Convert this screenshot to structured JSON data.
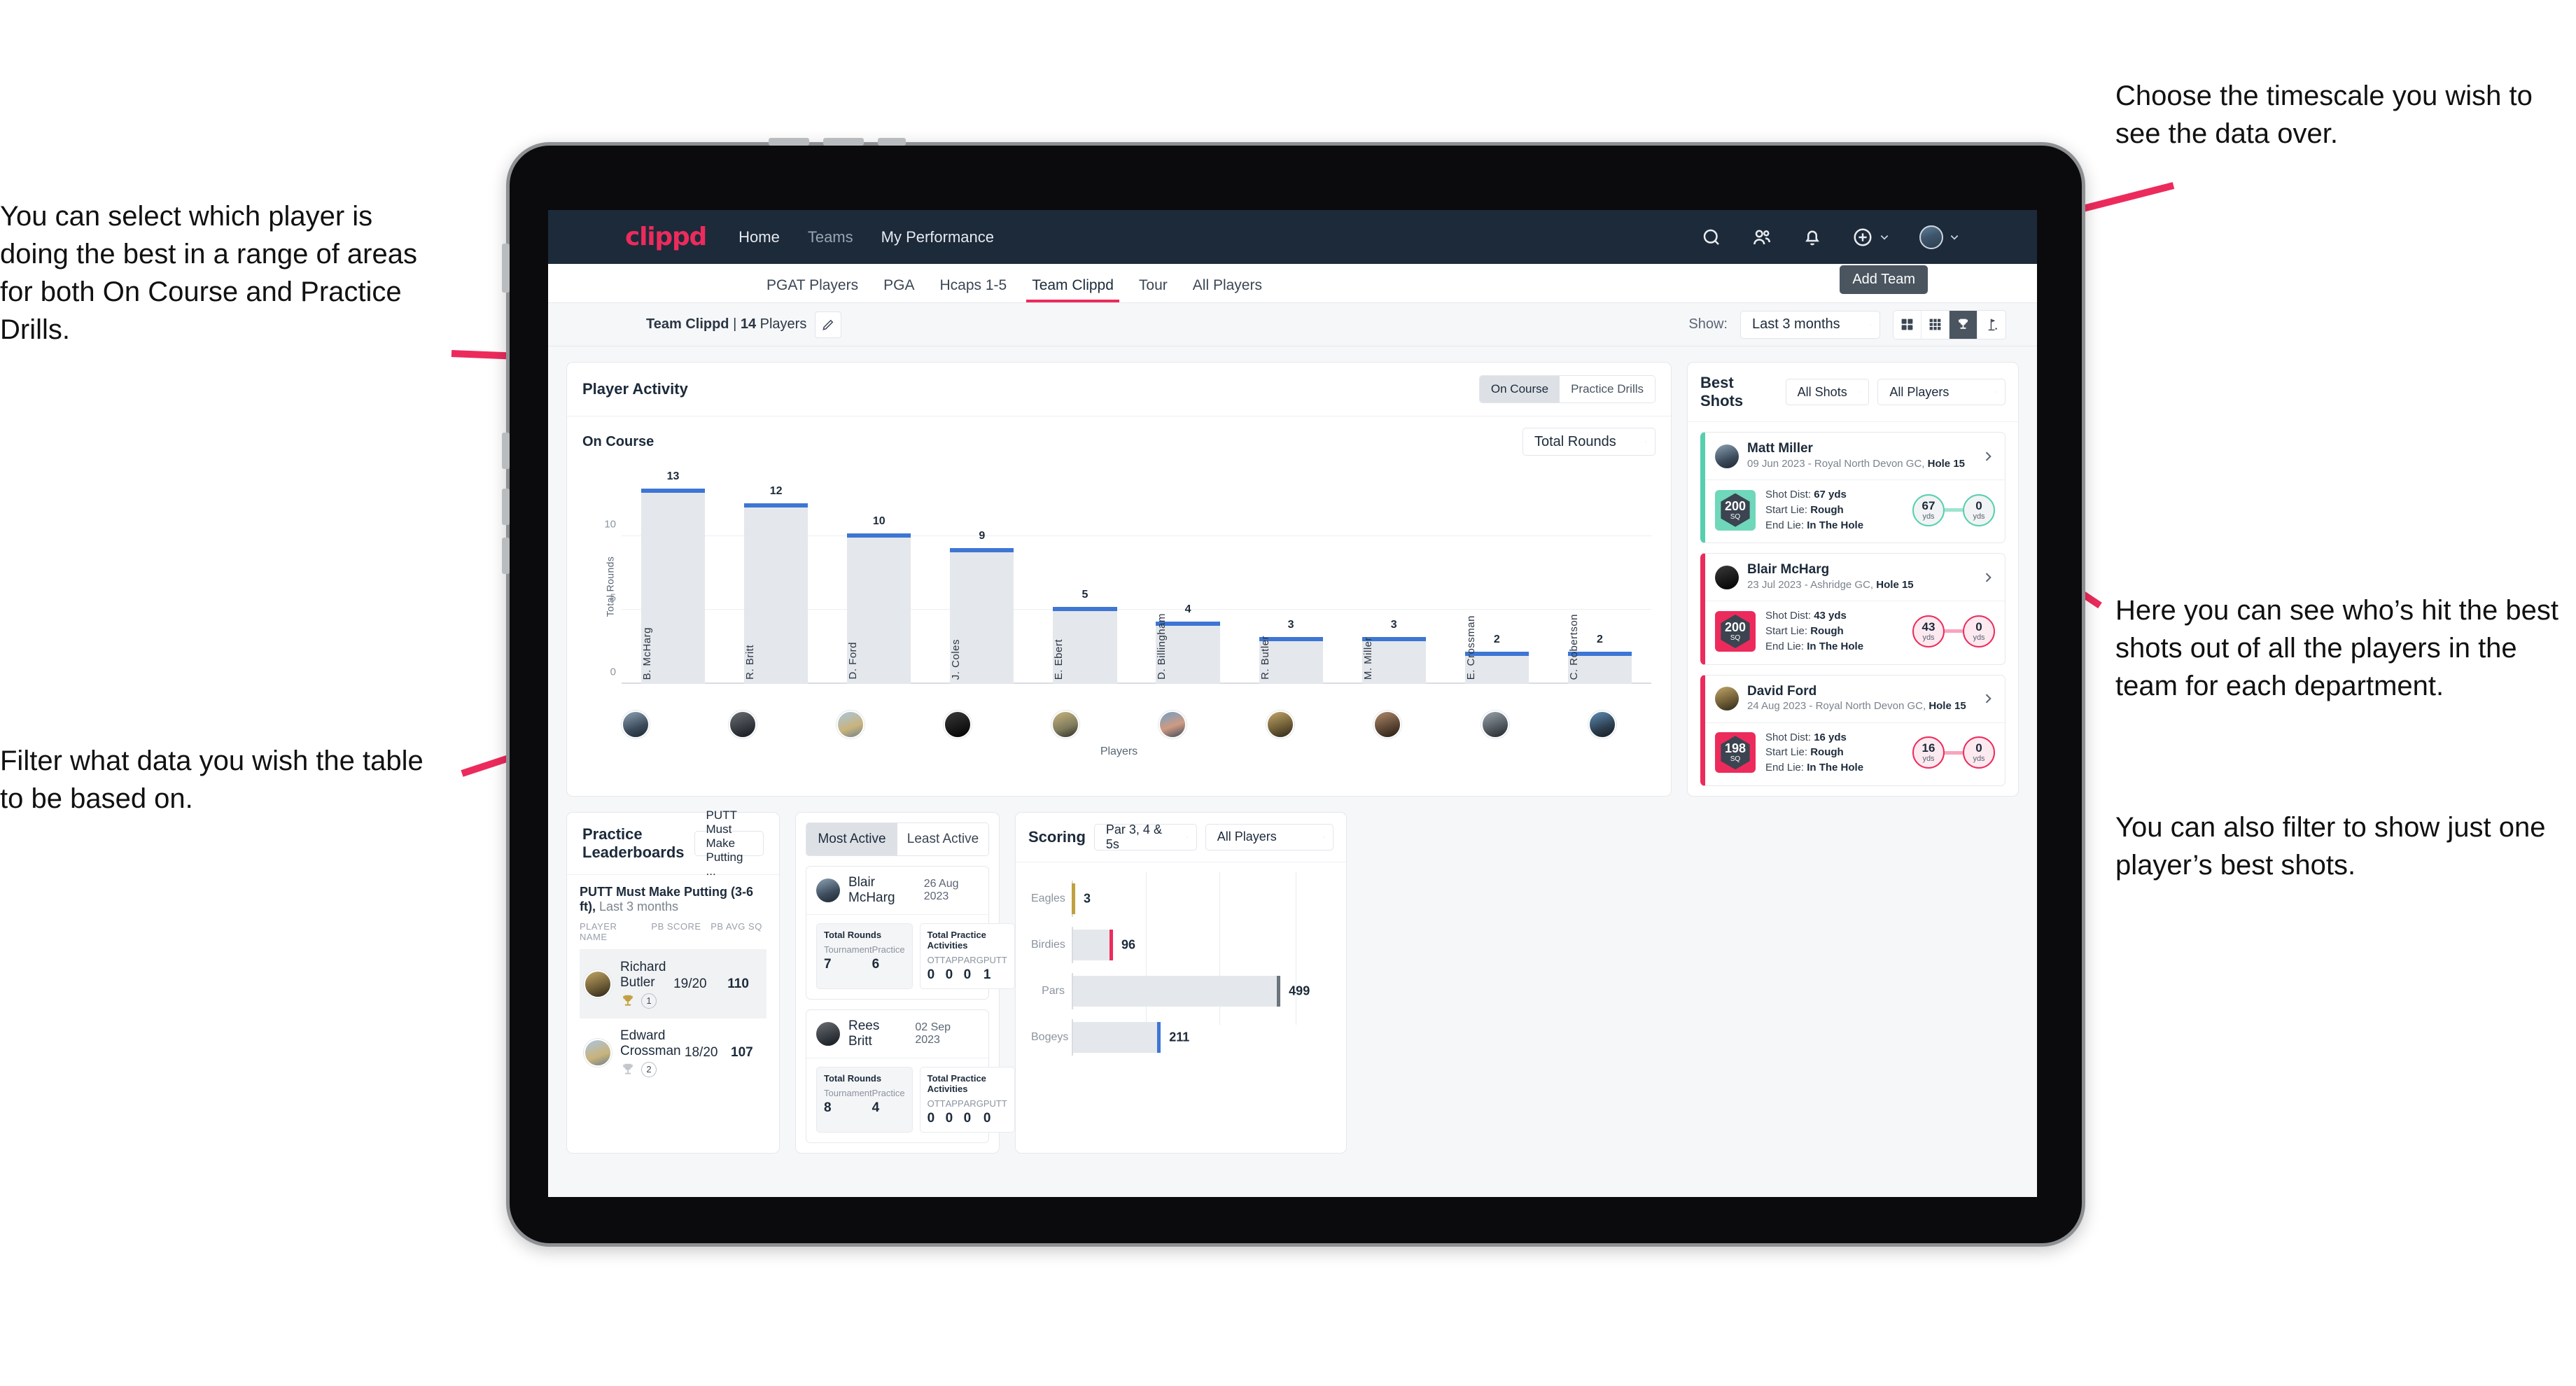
{
  "annotations": {
    "left_top": "You can select which player is doing the best in a range of areas for both On Course and Practice Drills.",
    "left_bottom": "Filter what data you wish the table to be based on.",
    "right_top": "Choose the timescale you wish to see the data over.",
    "right_middle": "Here you can see who’s hit the best shots out of all the players in the team for each department.",
    "right_bottom": "You can also filter to show just one player’s best shots."
  },
  "topnav": {
    "logo": "clippd",
    "links": [
      {
        "label": "Home",
        "active": true
      },
      {
        "label": "Teams",
        "active": false
      },
      {
        "label": "My Performance",
        "active": true
      }
    ],
    "icons": [
      "search-icon",
      "people-icon",
      "bell-icon",
      "plus-circle-icon",
      "avatar"
    ]
  },
  "tabs": [
    {
      "label": "PGAT Players",
      "active": false
    },
    {
      "label": "PGA",
      "active": false
    },
    {
      "label": "Hcaps 1-5",
      "active": false
    },
    {
      "label": "Team Clippd",
      "active": true
    },
    {
      "label": "Tour",
      "active": false
    },
    {
      "label": "All Players",
      "active": false
    }
  ],
  "tooltip": "Add Team",
  "subbar": {
    "team_name": "Team Clippd",
    "separator": " | ",
    "player_count": "14",
    "players_word": " Players",
    "show_label": "Show:",
    "timescale": "Last 3 months",
    "view_icons": [
      "grid-2x2-icon",
      "grid-3x3-icon",
      "trophy-icon",
      "golf-flag-icon"
    ],
    "active_view": "trophy-icon"
  },
  "player_activity": {
    "title": "Player Activity",
    "segments": [
      {
        "label": "On Course",
        "active": true
      },
      {
        "label": "Practice Drills",
        "active": false
      }
    ],
    "sub_label": "On Course",
    "metric_select": "Total Rounds"
  },
  "chart_data": {
    "type": "bar",
    "title": "Player Activity – On Course",
    "xlabel": "Players",
    "ylabel": "Total Rounds",
    "ylim": [
      0,
      14
    ],
    "yticks": [
      0,
      5,
      10
    ],
    "grid": true,
    "categories": [
      "B. McHarg",
      "R. Britt",
      "D. Ford",
      "J. Coles",
      "E. Ebert",
      "D. Billingham",
      "R. Butler",
      "M. Miller",
      "E. Crossman",
      "C. Robertson"
    ],
    "values": [
      13,
      12,
      10,
      9,
      5,
      4,
      3,
      3,
      2,
      2
    ]
  },
  "best_shots": {
    "title": "Best Shots",
    "shot_filter": "All Shots",
    "player_filter": "All Players",
    "items": [
      {
        "name": "Matt Miller",
        "meta_prefix": "09 Jun 2023 - Royal North Devon GC, ",
        "hole": "Hole 15",
        "sq": "200",
        "sq_unit": "SQ",
        "accent": "#6fd7ba",
        "shot_dist_label": "Shot Dist: ",
        "shot_dist": "67 yds",
        "start_lie_label": "Start Lie: ",
        "start_lie": "Rough",
        "end_lie_label": "End Lie: ",
        "end_lie": "In The Hole",
        "from_value": "67",
        "from_unit": "yds",
        "to_value": "0",
        "to_unit": "yds"
      },
      {
        "name": "Blair McHarg",
        "meta_prefix": "23 Jul 2023 - Ashridge GC, ",
        "hole": "Hole 15",
        "sq": "200",
        "sq_unit": "SQ",
        "accent": "#ec2b5c",
        "shot_dist_label": "Shot Dist: ",
        "shot_dist": "43 yds",
        "start_lie_label": "Start Lie: ",
        "start_lie": "Rough",
        "end_lie_label": "End Lie: ",
        "end_lie": "In The Hole",
        "from_value": "43",
        "from_unit": "yds",
        "to_value": "0",
        "to_unit": "yds"
      },
      {
        "name": "David Ford",
        "meta_prefix": "24 Aug 2023 - Royal North Devon GC, ",
        "hole": "Hole 15",
        "sq": "198",
        "sq_unit": "SQ",
        "accent": "#ec2b5c",
        "shot_dist_label": "Shot Dist: ",
        "shot_dist": "16 yds",
        "start_lie_label": "Start Lie: ",
        "start_lie": "Rough",
        "end_lie_label": "End Lie: ",
        "end_lie": "In The Hole",
        "from_value": "16",
        "from_unit": "yds",
        "to_value": "0",
        "to_unit": "yds"
      }
    ]
  },
  "practice_leaderboards": {
    "title": "Practice Leaderboards",
    "drill_select": "PUTT Must Make Putting ...",
    "subtitle_bold": "PUTT Must Make Putting (3-6 ft),",
    "subtitle_rest": " Last 3 months",
    "columns": [
      "PLAYER NAME",
      "PB SCORE",
      "PB AVG SQ"
    ],
    "rows": [
      {
        "name": "Richard Butler",
        "rank": "1",
        "trophy": "gold",
        "pb_score": "19/20",
        "pb_avg_sq": "110",
        "highlight": true
      },
      {
        "name": "Edward Crossman",
        "rank": "2",
        "trophy": "silver",
        "pb_score": "18/20",
        "pb_avg_sq": "107",
        "highlight": false
      }
    ]
  },
  "activity": {
    "tabs": [
      {
        "label": "Most Active",
        "active": true
      },
      {
        "label": "Least Active",
        "active": false
      }
    ],
    "rounds_title": "Total Rounds",
    "practice_title": "Total Practice Activities",
    "rounds_keys": [
      "Tournament",
      "Practice"
    ],
    "practice_keys": [
      "OTT",
      "APP",
      "ARG",
      "PUTT"
    ],
    "cards": [
      {
        "name": "Blair McHarg",
        "date": "26 Aug 2023",
        "rounds_values": [
          "7",
          "6"
        ],
        "practice_values": [
          "0",
          "0",
          "0",
          "1"
        ]
      },
      {
        "name": "Rees Britt",
        "date": "02 Sep 2023",
        "rounds_values": [
          "8",
          "4"
        ],
        "practice_values": [
          "0",
          "0",
          "0",
          "0"
        ]
      }
    ]
  },
  "scoring": {
    "title": "Scoring",
    "par_filter": "Par 3, 4 & 5s",
    "player_filter": "All Players",
    "chart": {
      "type": "bar",
      "orientation": "horizontal",
      "categories": [
        "Eagles",
        "Birdies",
        "Pars",
        "Bogeys"
      ],
      "values": [
        3,
        96,
        499,
        211
      ],
      "colors": [
        "#c0a041",
        "#ec2b5c",
        "#6c757d",
        "#3d76d4"
      ],
      "xmax": 620,
      "grid": true
    }
  },
  "colors": {
    "brand_pink": "#ec2b5c",
    "nav_dark": "#1c2a3a",
    "bar_blue": "#3d76d4",
    "teal": "#6fd7ba"
  }
}
